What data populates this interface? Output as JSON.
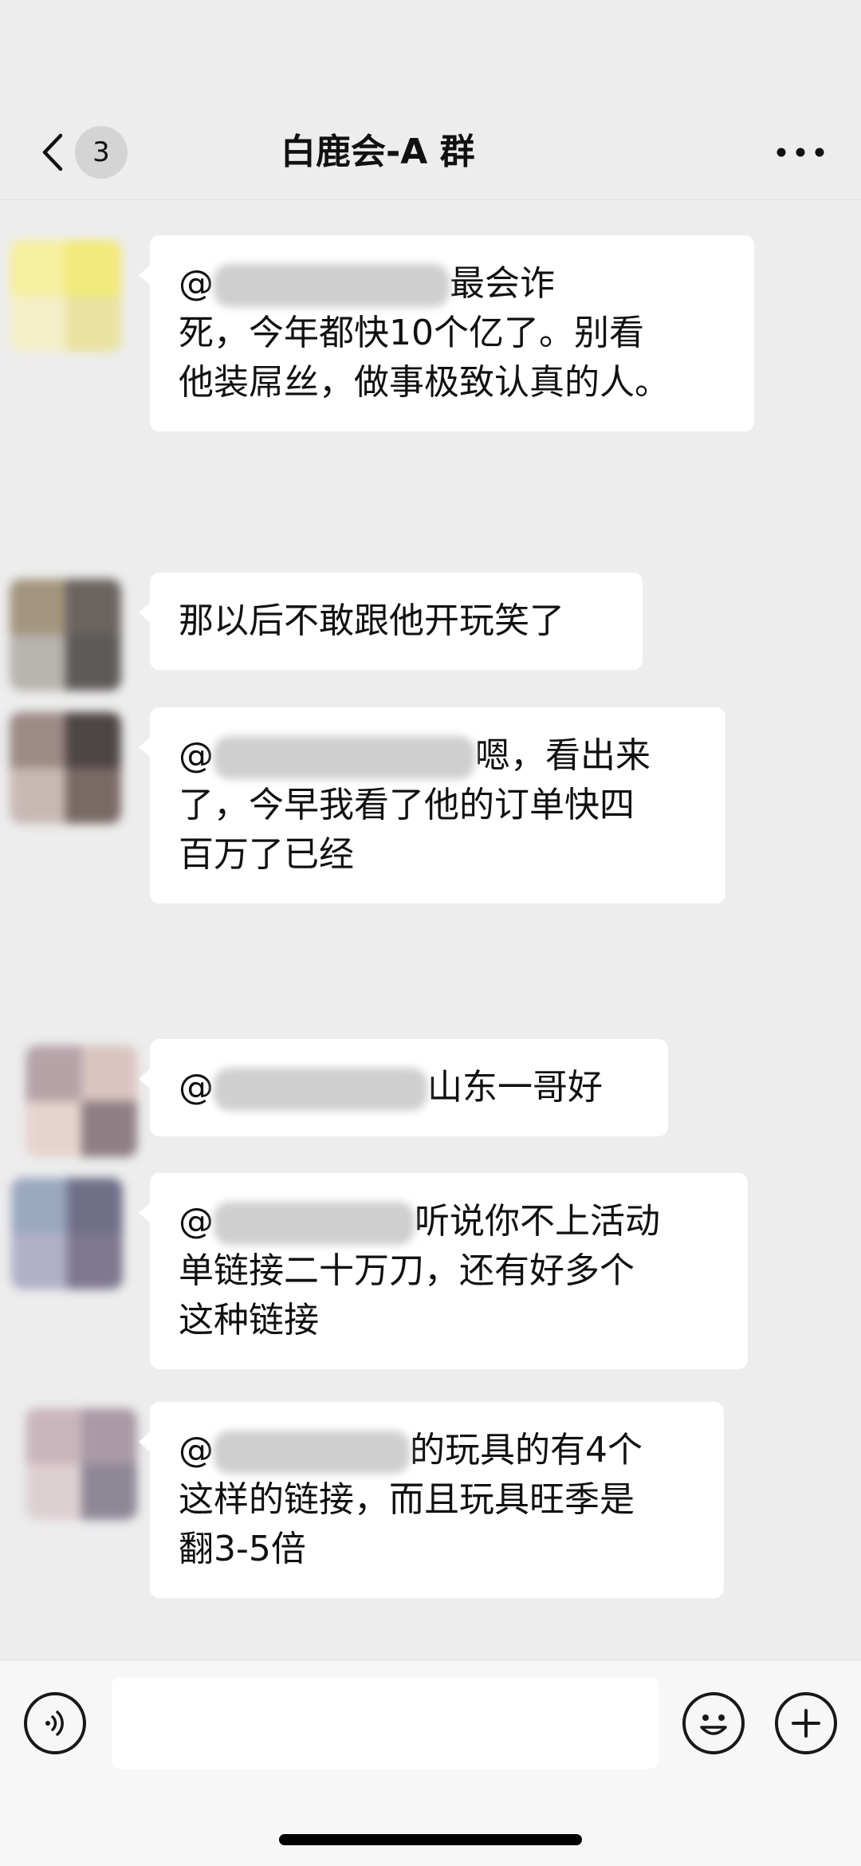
{
  "header": {
    "unread_count": "3",
    "title": "白鹿会-A 群"
  },
  "messages": [
    {
      "lines": [
        {
          "pre": "@",
          "post": "最会诈"
        },
        {
          "text": "死，今年都快10个亿了。别看"
        },
        {
          "text": "他装屌丝，做事极致认真的人。"
        }
      ],
      "avatar_colors": [
        "#f6ef9e",
        "#f2ea7a",
        "#f3f0c8",
        "#e9e2a0"
      ]
    },
    {
      "text": "那以后不敢跟他开玩笑了",
      "avatar_colors": [
        "#a4967e",
        "#6a6460",
        "#b7b3ad",
        "#5e5a58"
      ]
    },
    {
      "lines": [
        {
          "pre": "@",
          "post": "嗯，看出来"
        },
        {
          "text": "了，今早我看了他的订单快四"
        },
        {
          "text": "百万了已经"
        }
      ],
      "avatar_colors": [
        "#9c8a86",
        "#4d4644",
        "#c7b9b4",
        "#7a6a66"
      ]
    },
    {
      "lines": [
        {
          "pre": "@",
          "post": "山东一哥好"
        }
      ],
      "avatar_colors": [
        "#b5a3a8",
        "#d9c4c0",
        "#e6d3cd",
        "#8f7f85"
      ]
    },
    {
      "lines": [
        {
          "pre": "@",
          "post": "听说你不上活动"
        },
        {
          "text": "单链接二十万刀，还有好多个"
        },
        {
          "text": "这种链接"
        }
      ],
      "avatar_colors": [
        "#9aa8c0",
        "#6f6f88",
        "#b0b0c8",
        "#7e7890"
      ]
    },
    {
      "lines": [
        {
          "pre": "@",
          "post": "的玩具的有4个"
        },
        {
          "text": "这样的链接，而且玩具旺季是"
        },
        {
          "text": "翻3-5倍"
        }
      ],
      "avatar_colors": [
        "#c9b6bc",
        "#a99aa6",
        "#ddd0d2",
        "#8e8896"
      ]
    }
  ],
  "composer": {
    "placeholder": ""
  },
  "icons": {
    "back": "chevron-left-icon",
    "more": "more-horizontal-icon",
    "voice": "voice-icon",
    "emoji": "emoji-icon",
    "plus": "plus-icon"
  },
  "colors": {
    "background": "#ededed",
    "bubble": "#ffffff",
    "badge": "#d4d4d4"
  }
}
